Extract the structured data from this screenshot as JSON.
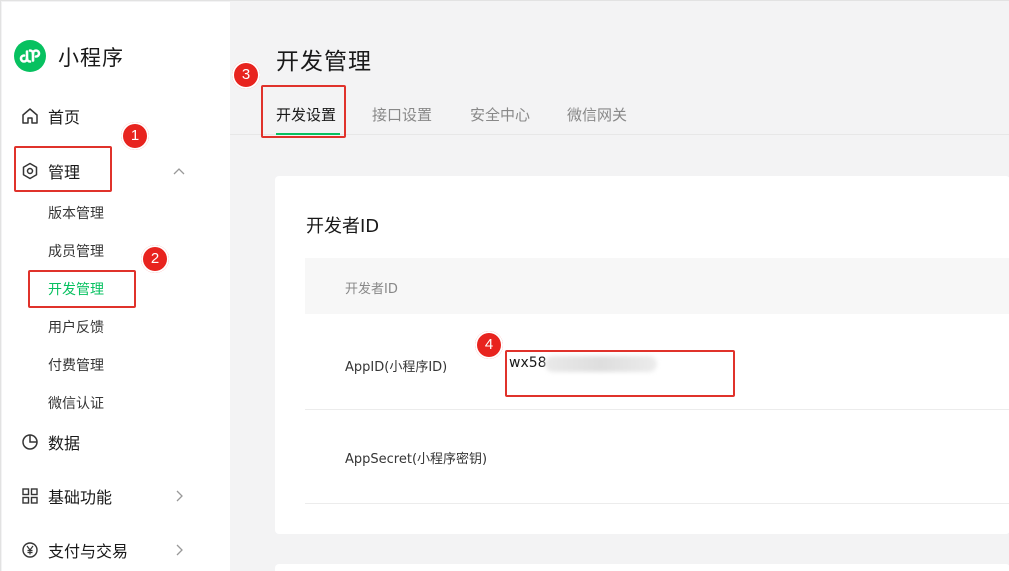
{
  "sidebar": {
    "app_name": "小程序",
    "nav": {
      "home": "首页",
      "manage": "管理",
      "data": "数据",
      "basic": "基础功能",
      "pay": "支付与交易"
    },
    "sub_items": [
      "版本管理",
      "成员管理",
      "开发管理",
      "用户反馈",
      "付费管理",
      "微信认证"
    ]
  },
  "main": {
    "page_title": "开发管理",
    "tabs": [
      "开发设置",
      "接口设置",
      "安全中心",
      "微信网关"
    ],
    "section_title": "开发者ID",
    "table_header": "开发者ID",
    "rows": {
      "appid_label": "AppID(小程序ID)",
      "appid_value": "wx58",
      "appsecret_label": "AppSecret(小程序密钥)"
    }
  },
  "annotations": {
    "badges": [
      "1",
      "2",
      "3",
      "4"
    ],
    "color": "#e8231e"
  },
  "colors": {
    "accent": "#07c160"
  }
}
